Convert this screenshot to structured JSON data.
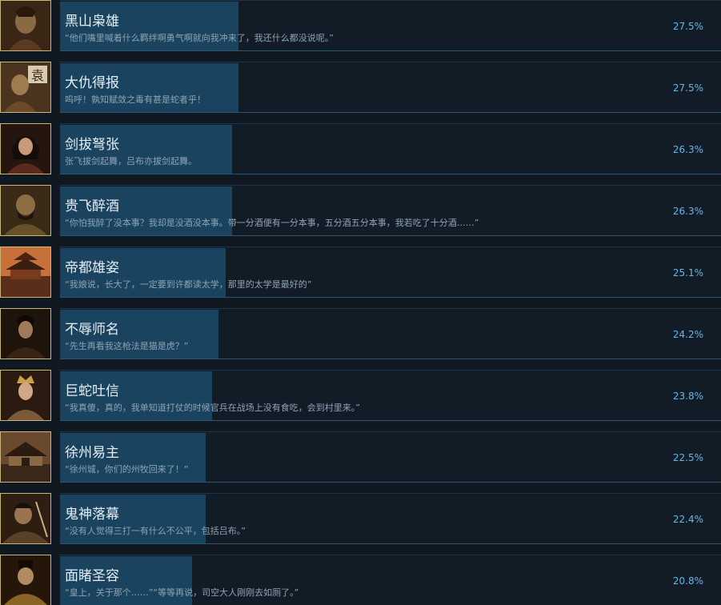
{
  "achievements": [
    {
      "title": "黑山枭雄",
      "description": "“他们嘴里喊着什么羁绊啊勇气啊就向我冲来了，我还什么都没说呢。”",
      "percent": "27.5%",
      "icon": "warlord-portrait-icon",
      "fill": 0.27
    },
    {
      "title": "大仇得报",
      "description": "呜呼！孰知赋敛之毒有甚是蛇者乎！",
      "percent": "27.5%",
      "icon": "armored-general-portrait-icon",
      "fill": 0.27
    },
    {
      "title": "剑拔弩张",
      "description": "张飞拔剑起舞，吕布亦拔剑起舞。",
      "percent": "26.3%",
      "icon": "lady-portrait-icon",
      "fill": 0.26
    },
    {
      "title": "贵飞醉酒",
      "description": "“你怕我醉了没本事？我却是没酒没本事。带一分酒便有一分本事，五分酒五分本事，我若吃了十分酒……”",
      "percent": "26.3%",
      "icon": "bearded-warrior-portrait-icon",
      "fill": 0.26
    },
    {
      "title": "帝都雄姿",
      "description": "“我娘说，长大了，一定要到许都读太学，那里的太学是最好的”",
      "percent": "25.1%",
      "icon": "imperial-palace-icon",
      "fill": 0.25
    },
    {
      "title": "不辱师名",
      "description": "“先生再看我这枪法是猫是虎？”",
      "percent": "24.2%",
      "icon": "young-warrior-portrait-icon",
      "fill": 0.24
    },
    {
      "title": "巨蛇吐信",
      "description": "“我真傻，真的，我单知道打仗的时候官兵在战场上没有食吃，会到村里来。”",
      "percent": "23.8%",
      "icon": "crowned-lady-portrait-icon",
      "fill": 0.23
    },
    {
      "title": "徐州易主",
      "description": "“徐州城，你们的州牧回来了！”",
      "percent": "22.5%",
      "icon": "city-fortress-icon",
      "fill": 0.22
    },
    {
      "title": "鬼神落幕",
      "description": "“没有人觉得三打一有什么不公平，包括吕布。”",
      "percent": "22.4%",
      "icon": "fallen-warlord-portrait-icon",
      "fill": 0.22
    },
    {
      "title": "面睹圣容",
      "description": "“皇上，关于那个……”“等等再说，司空大人刚刚去如厕了。”",
      "percent": "20.8%",
      "icon": "robed-minister-portrait-icon",
      "fill": 0.2
    }
  ],
  "colors": {
    "background": "#101822",
    "progress_fill": "#19435e",
    "percent_text": "#67b6e8",
    "icon_border": "#c9b57a"
  }
}
